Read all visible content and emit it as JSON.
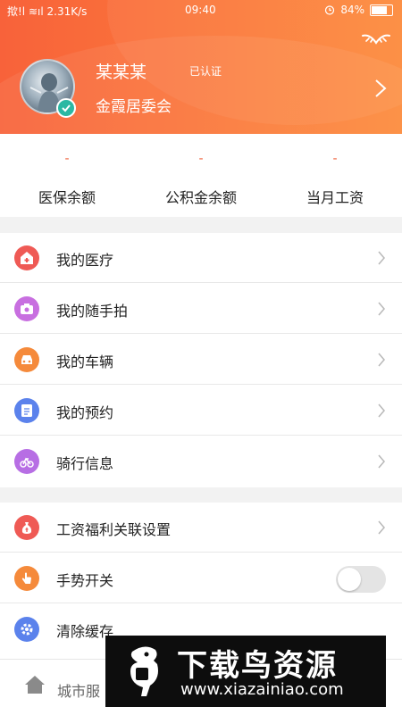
{
  "status_bar": {
    "left": "揿!l ≋ıl 2.31K/s",
    "time": "09:40",
    "battery_text": "84%",
    "battery_level": 0.84
  },
  "profile": {
    "name": "某某某",
    "verified": "已认证",
    "org": "金霞居委会"
  },
  "stats": [
    {
      "value": "-",
      "label": "医保余额"
    },
    {
      "value": "-",
      "label": "公积金余额"
    },
    {
      "value": "-",
      "label": "当月工资"
    }
  ],
  "menu_group_1": [
    {
      "label": "我的医疗",
      "icon": "medical-icon",
      "color": "#ef5a55"
    },
    {
      "label": "我的随手拍",
      "icon": "camera-icon",
      "color": "#c86fe0"
    },
    {
      "label": "我的车辆",
      "icon": "car-icon",
      "color": "#f58a3b"
    },
    {
      "label": "我的预约",
      "icon": "appointment-icon",
      "color": "#5b82ec"
    },
    {
      "label": "骑行信息",
      "icon": "bike-icon",
      "color": "#b76ee4"
    }
  ],
  "menu_group_2": [
    {
      "label": "工资福利关联设置",
      "icon": "money-bag-icon",
      "color": "#ef5a55"
    },
    {
      "label": "手势开关",
      "icon": "gesture-icon",
      "color": "#f58a3b",
      "toggle_on": false
    },
    {
      "label": "清除缓存",
      "icon": "gear-icon",
      "color": "#5b82ec"
    }
  ],
  "tabbar": {
    "label": "城市服"
  },
  "watermark": {
    "title": "下载鸟资源",
    "url": "www.xiazainiao.com"
  },
  "colors": {
    "accent": "#f8623a",
    "stat_value": "#f0603a",
    "divider": "#e8e8e8"
  }
}
